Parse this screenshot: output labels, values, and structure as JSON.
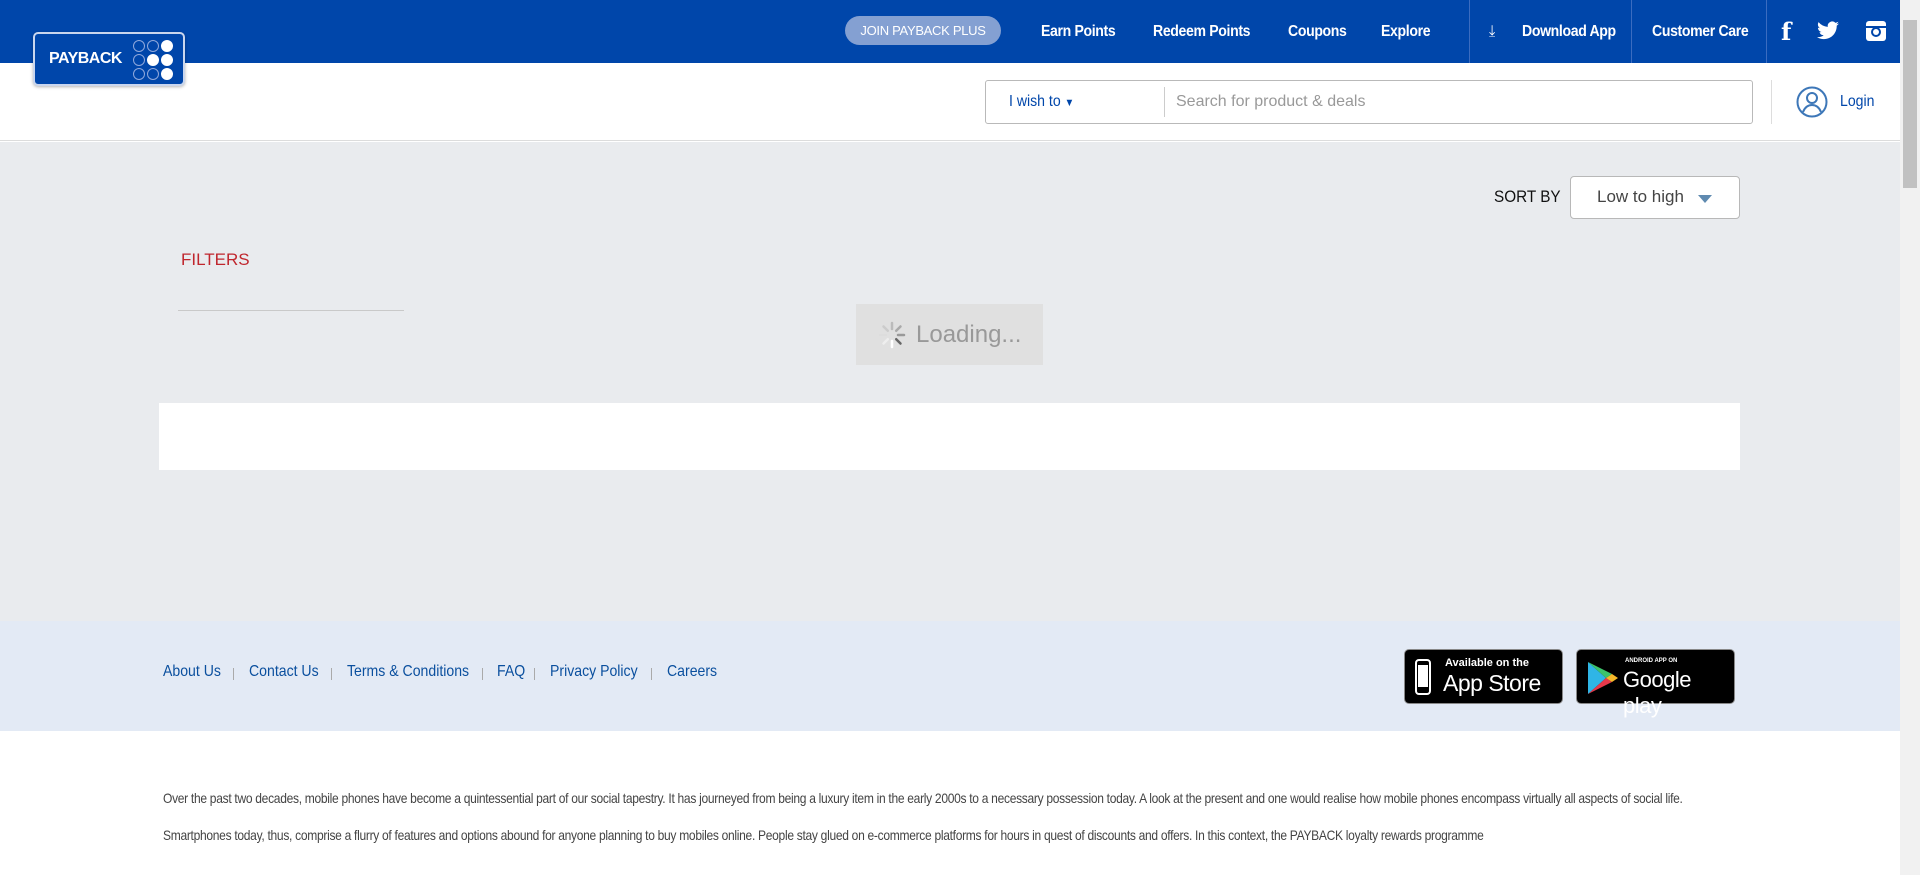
{
  "brand": {
    "logo_text": "PAYBACK"
  },
  "topnav": {
    "join": "JOIN PAYBACK PLUS",
    "items": [
      "Earn Points",
      "Redeem Points",
      "Coupons",
      "Explore"
    ],
    "download": "Download App",
    "customer_care": "Customer Care"
  },
  "search": {
    "wish": "I wish to",
    "placeholder": "Search for product & deals"
  },
  "login": "Login",
  "sort": {
    "label": "SORT BY",
    "value": "Low to high"
  },
  "filters": "FILTERS",
  "loading": "Loading...",
  "footer": {
    "links": [
      "About Us",
      "Contact Us",
      "Terms & Conditions",
      "FAQ",
      "Privacy Policy",
      "Careers"
    ],
    "appstore": {
      "small": "Available on the",
      "big": "App Store"
    },
    "googleplay": {
      "small": "ANDROID APP ON",
      "big": "Google play"
    }
  },
  "paragraphs": [
    "Over the past two decades, mobile phones have become a quintessential part of our social tapestry. It has journeyed from being a luxury item in the early 2000s to a necessary possession today. A look at the present and one would realise how mobile phones encompass virtually all aspects of social life.",
    "Smartphones today, thus, comprise a flurry of features and options abound for anyone planning to buy mobiles online. People stay glued on e-commerce platforms for hours in quest of discounts and offers. In this context, the PAYBACK loyalty rewards programme"
  ]
}
